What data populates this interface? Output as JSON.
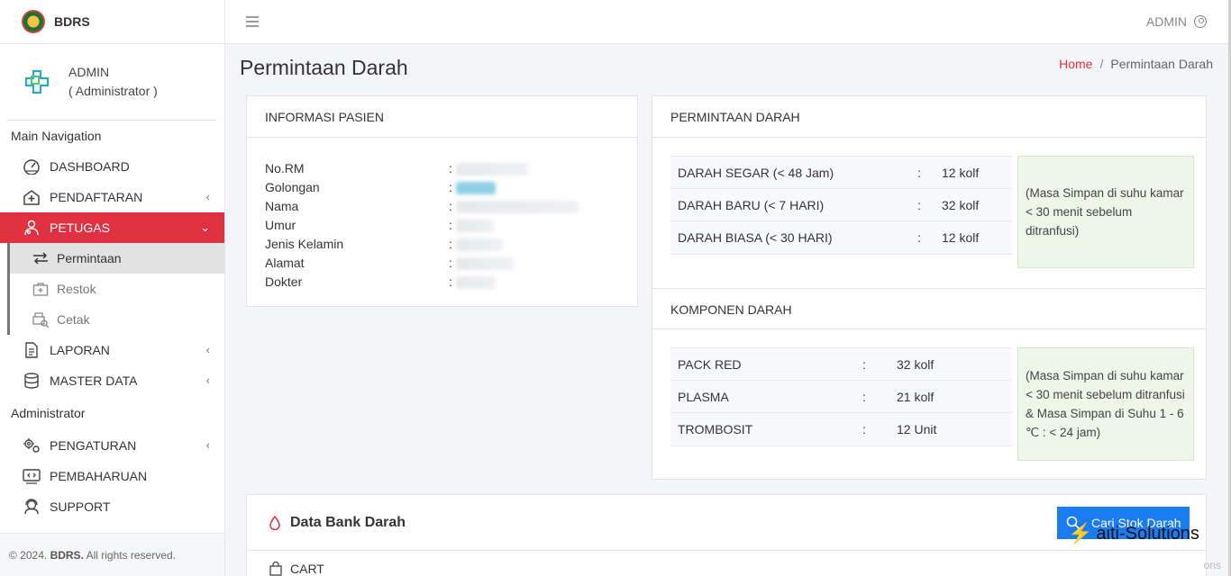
{
  "brand": {
    "name": "BDRS"
  },
  "user": {
    "name": "ADMIN",
    "role": "( Administrator )"
  },
  "sidebar": {
    "header_main": "Main Navigation",
    "items": [
      {
        "label": "DASHBOARD",
        "icon": "dashboard-icon"
      },
      {
        "label": "PENDAFTARAN",
        "icon": "hospital-icon"
      },
      {
        "label": "PETUGAS",
        "icon": "staff-icon"
      }
    ],
    "petugas_sub": [
      {
        "label": "Permintaan",
        "icon": "transfer-icon"
      },
      {
        "label": "Restok",
        "icon": "first-aid-icon"
      },
      {
        "label": "Cetak",
        "icon": "print-search-icon"
      }
    ],
    "items2": [
      {
        "label": "LAPORAN",
        "icon": "document-icon"
      },
      {
        "label": "MASTER DATA",
        "icon": "database-icon"
      }
    ],
    "header_admin": "Administrator",
    "admin_items": [
      {
        "label": "PENGATURAN",
        "icon": "gears-icon"
      },
      {
        "label": "PEMBAHARUAN",
        "icon": "update-icon"
      },
      {
        "label": "SUPPORT",
        "icon": "support-icon"
      }
    ],
    "chevron": "‹",
    "chevron_open": "⌄",
    "footer_prefix": "© 2024.",
    "footer_brand": "BDRS.",
    "footer_suffix": "All rights reserved."
  },
  "topbar": {
    "user": "ADMIN"
  },
  "page": {
    "title": "Permintaan Darah"
  },
  "breadcrumb": {
    "home": "Home",
    "sep": "/",
    "current": "Permintaan Darah"
  },
  "pasien": {
    "title": "INFORMASI PASIEN",
    "fields": [
      "No.RM",
      "Golongan",
      "Nama",
      "Umur",
      "Jenis Kelamin",
      "Alamat",
      "Dokter"
    ],
    "colon": ":"
  },
  "permintaan": {
    "title": "PERMINTAAN DARAH",
    "rows": [
      {
        "name": "DARAH SEGAR (< 48 Jam)",
        "value": "12 kolf"
      },
      {
        "name": "DARAH BARU (< 7 HARI)",
        "value": "32 kolf"
      },
      {
        "name": "DARAH BIASA (< 30 HARI)",
        "value": "12 kolf"
      }
    ],
    "note": "(Masa Simpan di suhu kamar < 30 menit sebelum ditranfusi)"
  },
  "komponen": {
    "title": "KOMPONEN DARAH",
    "rows": [
      {
        "name": "PACK RED",
        "value": "32 kolf"
      },
      {
        "name": "PLASMA",
        "value": "21 kolf"
      },
      {
        "name": "TROMBOSIT",
        "value": "12 Unit"
      }
    ],
    "note": "(Masa Simpan di suhu kamar < 30 menit sebelum ditranfusi & Masa Simpan di Suhu 1 - 6 ℃ : < 24 jam)"
  },
  "bank": {
    "title": "Data Bank Darah",
    "button": "Cari Stok Darah",
    "cart": "CART"
  },
  "watermark": {
    "text": "aiti-Solutions",
    "tail": "ons"
  },
  "colors": {
    "accent": "#e03140",
    "primary": "#1a7cf0",
    "note_bg": "#eef6e9"
  }
}
